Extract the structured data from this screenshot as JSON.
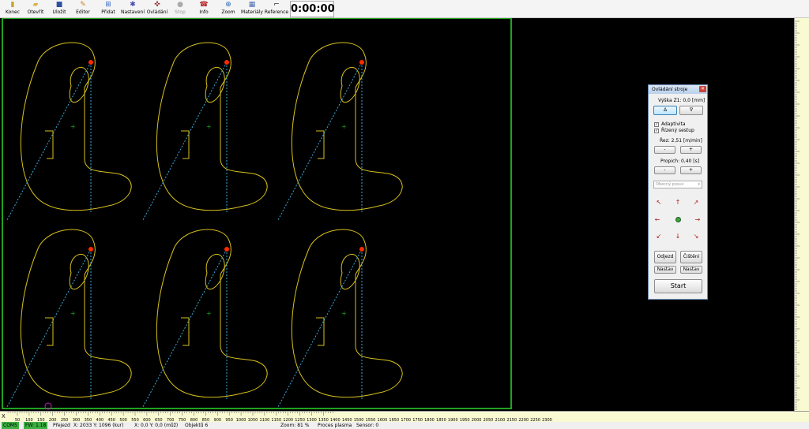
{
  "toolbar": {
    "buttons": [
      {
        "label": "Konec",
        "icon": "exit-icon"
      },
      {
        "label": "Otevřít",
        "icon": "folder-open-icon"
      },
      {
        "label": "Uložit",
        "icon": "save-icon"
      },
      {
        "label": "Editor",
        "icon": "editor-icon"
      },
      {
        "label": "Přidat",
        "icon": "add-icon"
      },
      {
        "label": "Nastavení",
        "icon": "settings-icon"
      },
      {
        "label": "Ovládání",
        "icon": "control-icon"
      },
      {
        "label": "Stop",
        "icon": "stop-icon"
      },
      {
        "label": "Info",
        "icon": "info-icon"
      },
      {
        "label": "Zoom",
        "icon": "zoom-icon"
      },
      {
        "label": "Materiály",
        "icon": "materials-icon"
      },
      {
        "label": "Reference",
        "icon": "reference-icon"
      }
    ],
    "timer": "0:00:00"
  },
  "panel": {
    "title": "Ovládání stroje",
    "height_label": "Výška Z1: 0,0 [mm]",
    "up_button": "Δ",
    "down_button": "∇",
    "adaptivita_label": "Adaptivita",
    "rizeny_label": "Řízený sestup",
    "rez_label": "Řez: 2,51 [m/min]",
    "propich_label": "Propich: 0,40 [s]",
    "minus": "-",
    "plus": "+",
    "select_value": "Obecný posuv",
    "odjezd_button": "Odjezd",
    "cisteni_button": "Čištění",
    "nastav_left": "Nastav",
    "nastav_right": "Nastav",
    "start_button": "Start"
  },
  "hruler": {
    "x_label": "X",
    "ticks": [
      "50",
      "100",
      "150",
      "200",
      "250",
      "300",
      "350",
      "400",
      "450",
      "500",
      "550",
      "600",
      "650",
      "700",
      "750",
      "800",
      "850",
      "900",
      "950",
      "1000",
      "1050",
      "1100",
      "1150",
      "1200",
      "1250",
      "1300",
      "1350",
      "1400",
      "1450",
      "1500",
      "1550",
      "1600",
      "1650",
      "1700",
      "1750",
      "1800",
      "1850",
      "1900",
      "1950",
      "2000",
      "2050",
      "2100",
      "2150",
      "2200",
      "2250",
      "2300"
    ]
  },
  "status": {
    "port": "COM5",
    "fw": "FW: 1.18",
    "mode": "Přejezd",
    "xy_cur": "X: 2033  Y: 1096 (kur)",
    "xy_mu": "X: 0,0  Y: 0,0 (můž)",
    "objects": "Objektů 6",
    "zoom": "Zoom: 81 %",
    "process": "Proces plasma",
    "sensor": "Sensor: 0"
  },
  "colors": {
    "part_outline": "#d9c21c",
    "lead_line": "#3aa9d8",
    "pierce_point": "#ff2a00",
    "border": "#1fa31f",
    "canvas_bg": "#000000"
  }
}
